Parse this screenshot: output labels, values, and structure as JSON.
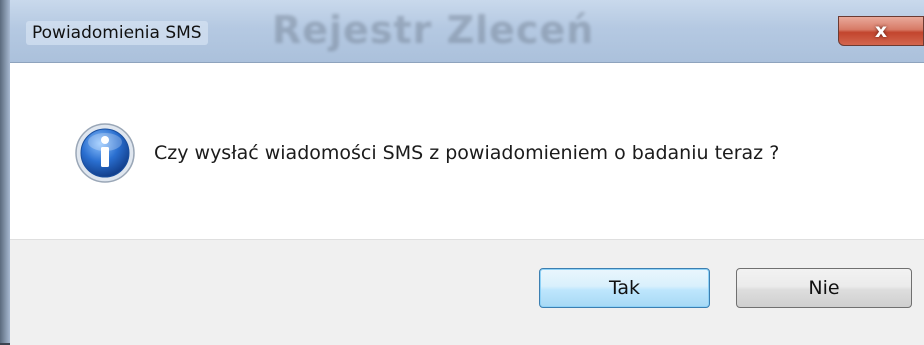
{
  "dialog": {
    "title": "Powiadomienia SMS",
    "background_window_title": "Rejestr Zleceń",
    "message": "Czy wysłać wiadomości SMS z powiadomieniem o badaniu teraz ?",
    "icon": "info-icon",
    "buttons": {
      "yes_label": "Tak",
      "no_label": "Nie"
    },
    "close_glyph": "x"
  },
  "colors": {
    "close_button": "#c2452e",
    "default_button_border": "#3c7fb1",
    "info_icon": "#1f5fbf"
  }
}
